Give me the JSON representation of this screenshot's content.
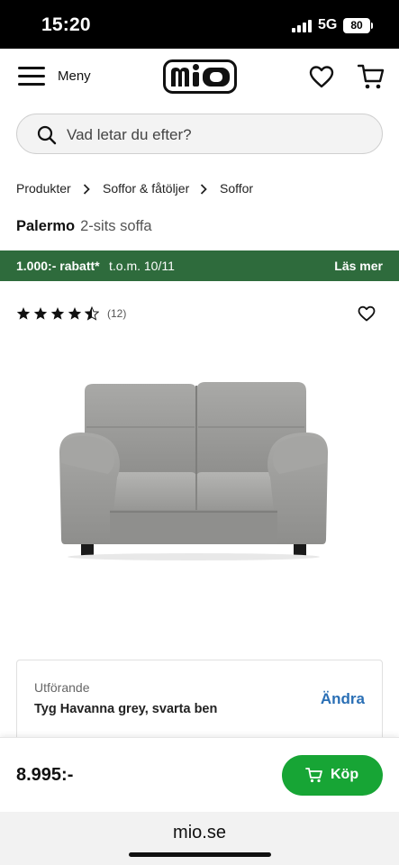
{
  "status_bar": {
    "time": "15:20",
    "network": "5G",
    "battery": "80"
  },
  "header": {
    "menu_label": "Meny",
    "logo_text": "mio"
  },
  "search": {
    "placeholder": "Vad letar du efter?"
  },
  "breadcrumb": [
    "Produkter",
    "Soffor & fåtöljer",
    "Soffor"
  ],
  "product": {
    "name": "Palermo",
    "subtitle": "2-sits soffa"
  },
  "promo": {
    "discount": "1.000:- rabatt*",
    "valid_until": "t.o.m. 10/11",
    "more": "Läs mer",
    "color": "#2e6b3c"
  },
  "rating": {
    "stars": 4.5,
    "max": 5,
    "count": "(12)"
  },
  "variant": {
    "label": "Utförande",
    "value": "Tyg Havanna grey, svarta ben",
    "change": "Ändra"
  },
  "purchase": {
    "price": "8.995:-",
    "button_label": "Köp",
    "button_color": "#17a535"
  },
  "browser": {
    "url": "mio.se"
  },
  "icons": {
    "menu": "hamburger-icon",
    "wishlist": "heart-icon",
    "cart": "cart-icon",
    "search": "search-icon",
    "chevron": "chevron-right-icon"
  }
}
